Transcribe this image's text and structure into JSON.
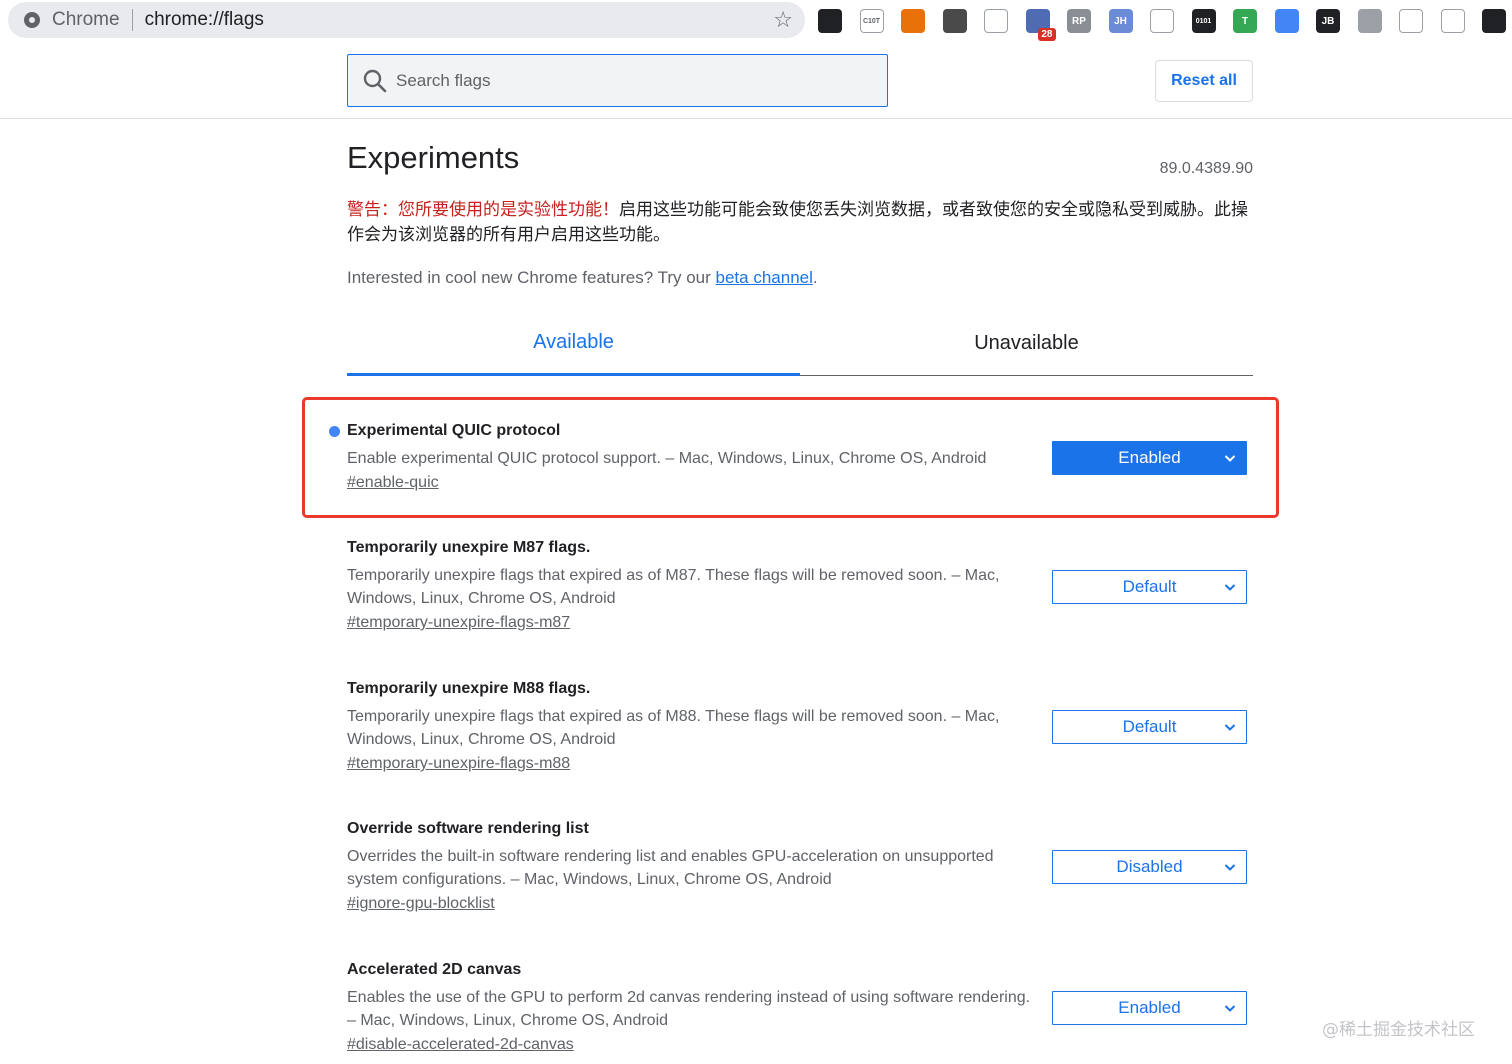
{
  "browser": {
    "site_name": "Chrome",
    "url": "chrome://flags",
    "extensions": [
      {
        "name": "github-ext-icon",
        "color": "#202124",
        "label": ""
      },
      {
        "name": "cmt-ext-icon",
        "color": "#ffffff",
        "label": "C10T"
      },
      {
        "name": "tree-ext-icon",
        "color": "#e8710a",
        "label": ""
      },
      {
        "name": "camera-ext-icon",
        "color": "#4a4a4a",
        "label": ""
      },
      {
        "name": "timer-ext-icon",
        "color": "#ffffff",
        "label": ""
      },
      {
        "name": "grid-ext-icon",
        "color": "#4e6bb3",
        "label": "",
        "badge": "28"
      },
      {
        "name": "rp-ext-icon",
        "color": "#8a8f95",
        "label": "RP"
      },
      {
        "name": "jh-ext-icon",
        "color": "#6a8cd6",
        "label": "JH"
      },
      {
        "name": "filter-ext-icon",
        "color": "#ffffff",
        "label": ""
      },
      {
        "name": "binary-ext-icon",
        "color": "#202124",
        "label": "0101"
      },
      {
        "name": "shield-ext-icon",
        "color": "#34a853",
        "label": "T"
      },
      {
        "name": "pen-ext-icon",
        "color": "#4285f4",
        "label": ""
      },
      {
        "name": "jb-ext-icon",
        "color": "#202124",
        "label": "JB"
      },
      {
        "name": "plane-ext-icon",
        "color": "#9aa0a6",
        "label": ""
      },
      {
        "name": "globe-ext-icon",
        "color": "#ffffff",
        "label": ""
      },
      {
        "name": "qr-ext-icon",
        "color": "#ffffff",
        "label": ""
      },
      {
        "name": "profile-ext-icon",
        "color": "#202124",
        "label": ""
      }
    ]
  },
  "header": {
    "search_placeholder": "Search flags",
    "reset_label": "Reset all"
  },
  "page": {
    "title": "Experiments",
    "version": "89.0.4389.90",
    "warning_red": "警告：您所要使用的是实验性功能！",
    "warning_rest": "启用这些功能可能会致使您丢失浏览数据，或者致使您的安全或隐私受到威胁。此操作会为该浏览器的所有用户启用这些功能。",
    "interest_text": "Interested in cool new Chrome features? Try our ",
    "interest_link": "beta channel",
    "interest_end": "."
  },
  "tabs": [
    {
      "label": "Available",
      "active": true
    },
    {
      "label": "Unavailable",
      "active": false
    }
  ],
  "flags": [
    {
      "title": "Experimental QUIC protocol",
      "description": "Enable experimental QUIC protocol support. – Mac, Windows, Linux, Chrome OS, Android",
      "link": "#enable-quic",
      "value": "Enabled",
      "modified": true
    },
    {
      "title": "Temporarily unexpire M87 flags.",
      "description": "Temporarily unexpire flags that expired as of M87. These flags will be removed soon. – Mac, Windows, Linux, Chrome OS, Android",
      "link": "#temporary-unexpire-flags-m87",
      "value": "Default",
      "modified": false
    },
    {
      "title": "Temporarily unexpire M88 flags.",
      "description": "Temporarily unexpire flags that expired as of M88. These flags will be removed soon. – Mac, Windows, Linux, Chrome OS, Android",
      "link": "#temporary-unexpire-flags-m88",
      "value": "Default",
      "modified": false
    },
    {
      "title": "Override software rendering list",
      "description": "Overrides the built-in software rendering list and enables GPU-acceleration on unsupported system configurations. – Mac, Windows, Linux, Chrome OS, Android",
      "link": "#ignore-gpu-blocklist",
      "value": "Disabled",
      "modified": false
    },
    {
      "title": "Accelerated 2D canvas",
      "description": "Enables the use of the GPU to perform 2d canvas rendering instead of using software rendering. – Mac, Windows, Linux, Chrome OS, Android",
      "link": "#disable-accelerated-2d-canvas",
      "value": "Enabled",
      "modified": false
    }
  ],
  "watermark": "@稀土掘金技术社区",
  "colors": {
    "accent": "#1a73e8",
    "warning": "#c5221f",
    "highlight": "#e8392a"
  }
}
